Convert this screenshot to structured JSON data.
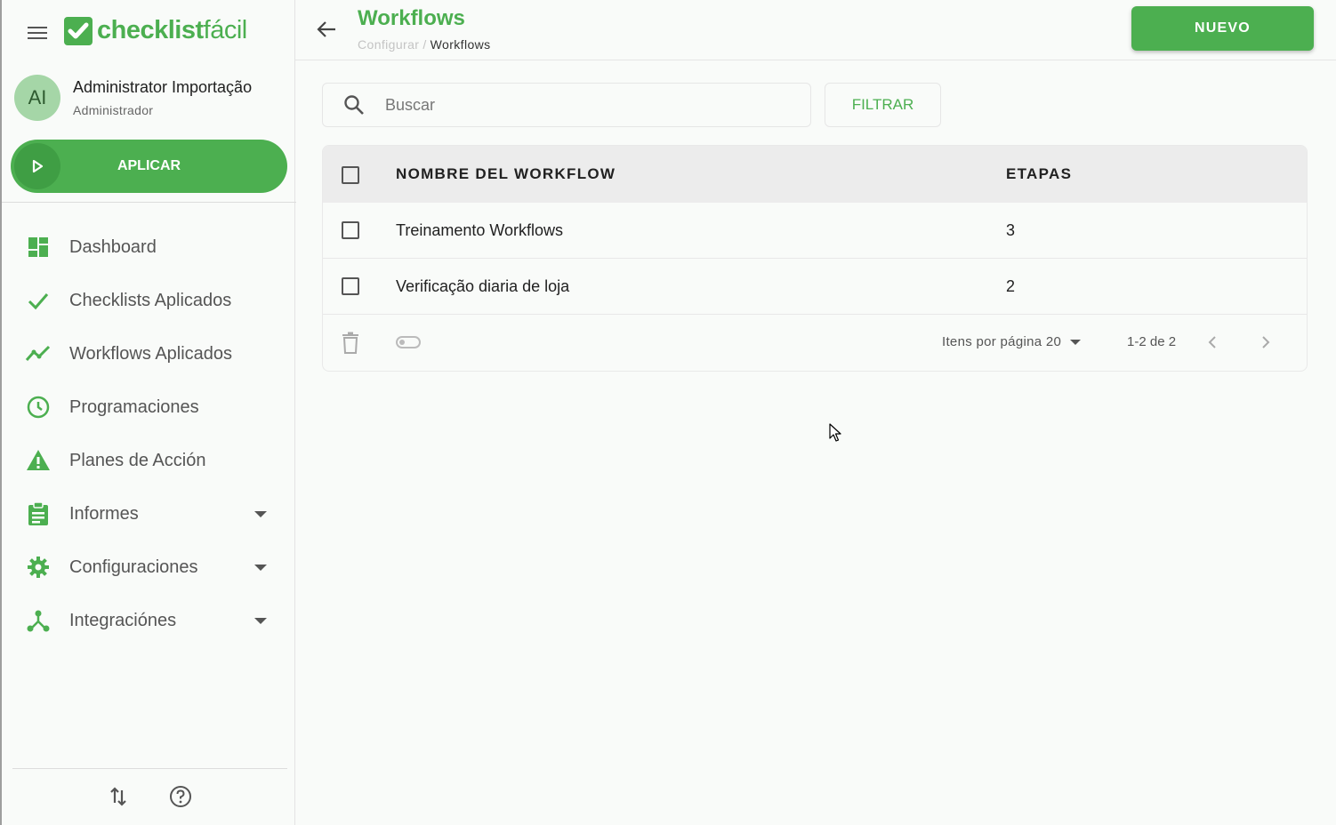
{
  "sidebar": {
    "logo": {
      "bold": "checklist",
      "light": "fácil"
    },
    "user": {
      "initials": "AI",
      "name": "Administrator Importação",
      "role": "Administrador"
    },
    "apply_label": "APLICAR",
    "items": [
      {
        "label": "Dashboard",
        "icon": "dashboard-icon",
        "expandable": false
      },
      {
        "label": "Checklists Aplicados",
        "icon": "check-icon",
        "expandable": false
      },
      {
        "label": "Workflows Aplicados",
        "icon": "trending-icon",
        "expandable": false
      },
      {
        "label": "Programaciones",
        "icon": "clock-icon",
        "expandable": false
      },
      {
        "label": "Planes de Acción",
        "icon": "warning-icon",
        "expandable": false
      },
      {
        "label": "Informes",
        "icon": "clipboard-icon",
        "expandable": true
      },
      {
        "label": "Configuraciones",
        "icon": "gear-icon",
        "expandable": true
      },
      {
        "label": "Integraciónes",
        "icon": "integration-icon",
        "expandable": true
      }
    ],
    "bottom_icons": [
      "sort-arrows-icon",
      "help-icon"
    ]
  },
  "header": {
    "title": "Workflows",
    "breadcrumb": {
      "parent": "Configurar",
      "separator": "/",
      "current": "Workflows"
    },
    "new_label": "NUEVO"
  },
  "search": {
    "placeholder": "Buscar",
    "value": ""
  },
  "filter_label": "FILTRAR",
  "table": {
    "columns": [
      "NOMBRE DEL WORKFLOW",
      "ETAPAS"
    ],
    "rows": [
      {
        "name": "Treinamento Workflows",
        "stages": "3"
      },
      {
        "name": "Verificação diaria de loja",
        "stages": "2"
      }
    ],
    "footer": {
      "per_page_label": "Itens por página",
      "per_page_value": "20",
      "range": "1-2 de 2"
    }
  },
  "colors": {
    "brand": "#4caf50",
    "brand_dark": "#3f9e44",
    "text": "#212121",
    "muted": "#555555"
  }
}
